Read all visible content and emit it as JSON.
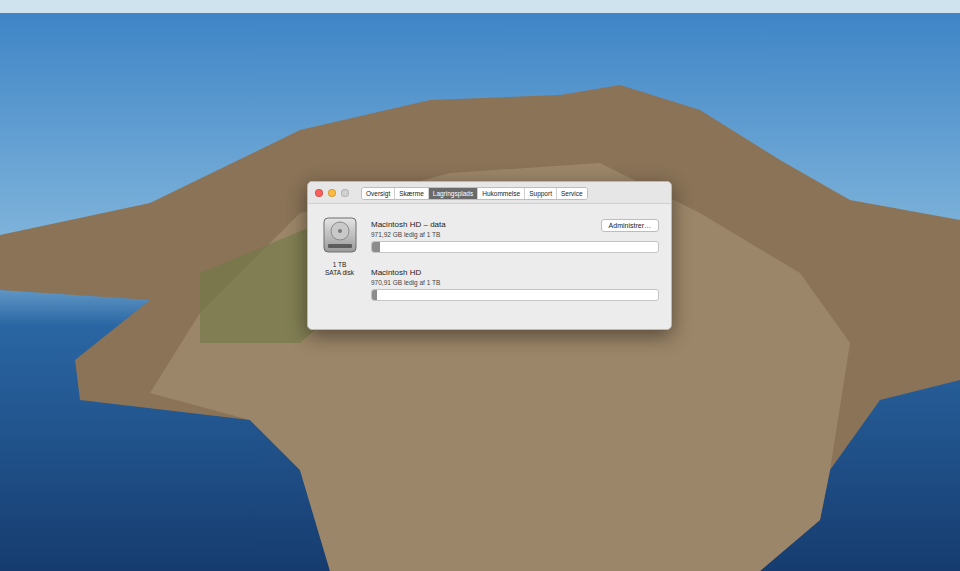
{
  "window": {
    "controls": [
      {
        "color": "#fc605c",
        "disabled": false
      },
      {
        "color": "#fcbb40",
        "disabled": false
      },
      {
        "color": "#d2d2d2",
        "disabled": true
      }
    ]
  },
  "tabs": [
    {
      "label": "Oversigt",
      "selected": false
    },
    {
      "label": "Skærme",
      "selected": false
    },
    {
      "label": "Lagringsplads",
      "selected": true
    },
    {
      "label": "Hukommelse",
      "selected": false
    },
    {
      "label": "Support",
      "selected": false
    },
    {
      "label": "Service",
      "selected": false
    }
  ],
  "disk": {
    "size": "1 TB",
    "type": "SATA disk"
  },
  "manage_button": "Administrer…",
  "volumes": [
    {
      "name": "Macintosh HD – data",
      "reading": "971,92 GB ledig af 1 TB",
      "level": 0.028
    },
    {
      "name": "Macintosh HD",
      "reading": "970,91 GB ledig af 1 TB",
      "level": 0.018
    }
  ]
}
